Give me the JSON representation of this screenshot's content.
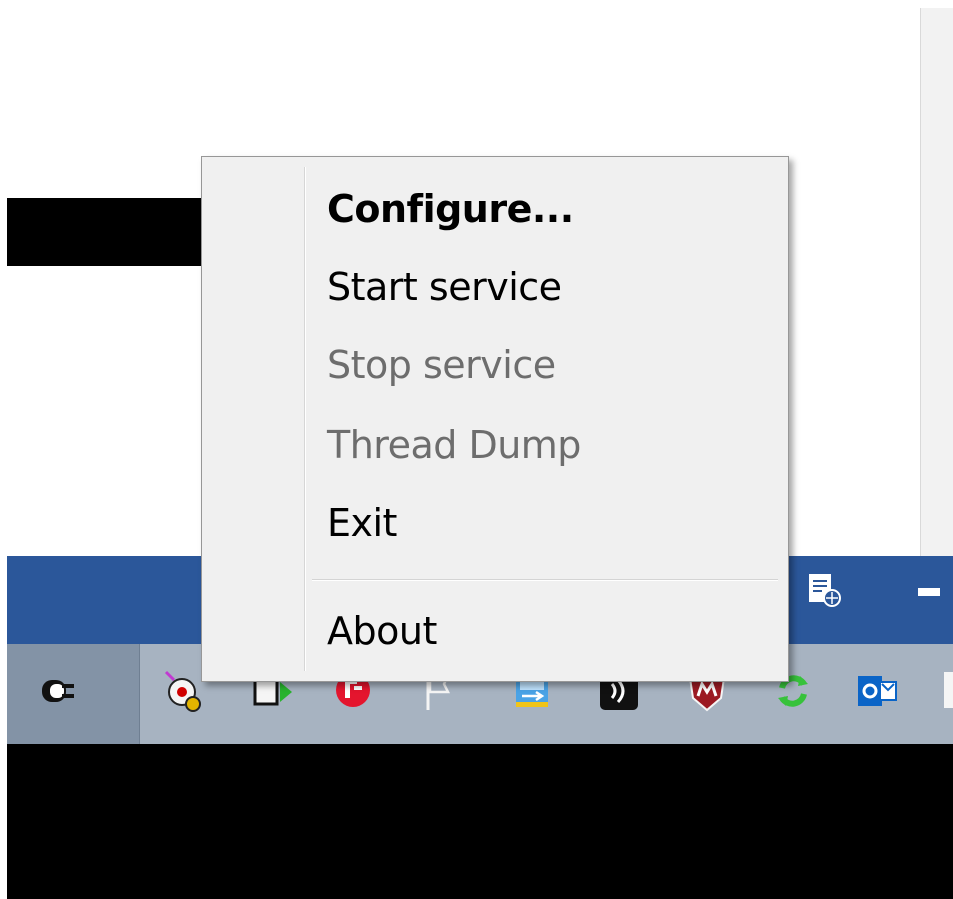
{
  "context_menu": {
    "items": [
      {
        "label": "Configure...",
        "state": "default"
      },
      {
        "label": "Start service",
        "state": "enabled"
      },
      {
        "label": "Stop service",
        "state": "disabled"
      },
      {
        "label": "Thread Dump",
        "state": "disabled"
      },
      {
        "label": "Exit",
        "state": "enabled"
      }
    ],
    "footer_item": {
      "label": "About",
      "state": "enabled"
    }
  },
  "tray": {
    "icons": [
      "power-plug-icon",
      "gear-notification-icon",
      "battery-play-icon",
      "f5-vpn-icon",
      "flag-icon",
      "network-sync-icon",
      "sound-waves-icon",
      "mcafee-shield-icon",
      "green-refresh-icon",
      "outlook-icon"
    ]
  },
  "strip": {
    "icons": [
      "document-globe-icon",
      "minimize-dash-icon"
    ]
  },
  "colors": {
    "menu_bg": "#f0f0f0",
    "menu_disabled_text": "#6d6d6d",
    "app_strip_blue": "#2b579a",
    "taskbar": "#a7b3c1"
  }
}
